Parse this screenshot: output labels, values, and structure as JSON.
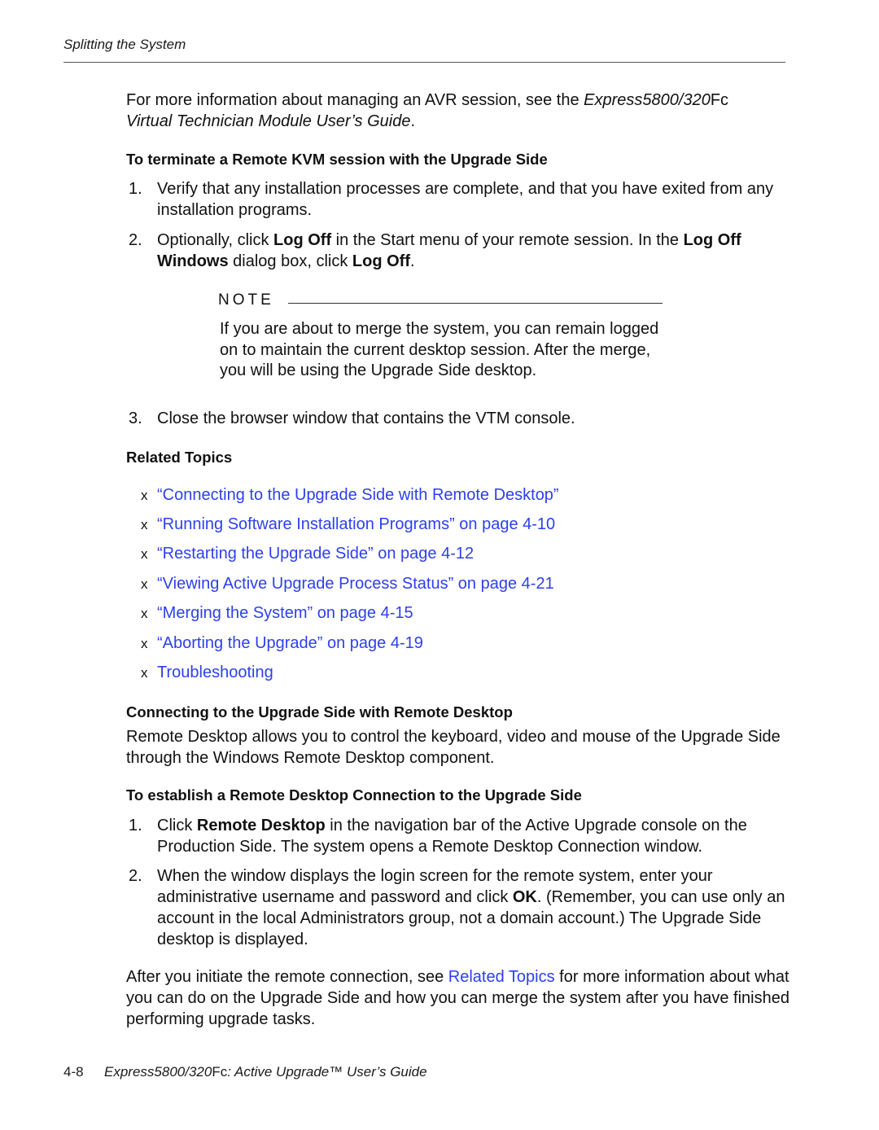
{
  "header": {
    "running_title": "Splitting the System"
  },
  "intro": {
    "text_before": "For more information about managing an AVR session, see the ",
    "guide_italic": "Express5800/320",
    "guide_suffix": "Fc",
    "guide_line2": "Virtual Technician Module User’s Guide",
    "text_after": "."
  },
  "section_kvm": {
    "heading": "To terminate a Remote KVM session with the Upgrade Side",
    "steps": [
      {
        "num": "1.",
        "text": "Verify that any installation processes are complete, and that you have exited from any installation programs."
      },
      {
        "num": "2.",
        "parts": [
          "Optionally, click ",
          "Log Off",
          " in the Start menu of your remote session. In the ",
          "Log Off Windows",
          " dialog box, click ",
          "Log Off",
          "."
        ]
      },
      {
        "num": "3.",
        "text": "Close the browser window that contains the VTM console."
      }
    ],
    "note": {
      "label": "NOTE",
      "text": "If you are about to merge the system, you can remain logged on to maintain the current desktop session. After the merge, you will be using the Upgrade Side desktop."
    }
  },
  "related_topics": {
    "heading": "Related Topics",
    "bullet": "x",
    "items": [
      "“Connecting to the Upgrade Side with Remote Desktop”",
      "“Running Software Installation Programs” on page 4-10",
      "“Restarting the Upgrade Side” on page 4-12",
      "“Viewing Active Upgrade Process Status” on page 4-21",
      "“Merging the System” on page 4-15",
      "“Aborting the Upgrade” on page 4-19",
      "Troubleshooting"
    ]
  },
  "section_rdp": {
    "heading": "Connecting to the Upgrade Side with Remote Desktop",
    "intro": "Remote Desktop allows you to control the keyboard, video and mouse of the Upgrade Side through the Windows Remote Desktop component.",
    "subheading": "To establish a Remote Desktop Connection to the Upgrade Side",
    "steps": [
      {
        "num": "1.",
        "parts": [
          "Click ",
          "Remote Desktop",
          " in the navigation bar of the Active Upgrade console on the Production Side. The system opens a Remote Desktop Connection window."
        ]
      },
      {
        "num": "2.",
        "parts": [
          "When the window displays the login screen for the remote system, enter your administrative username and password and click ",
          "OK",
          ". (Remember, you can use only an account in the local Administrators group, not a domain account.) The Upgrade Side desktop is displayed."
        ]
      }
    ],
    "closing": {
      "before": "After you initiate the remote connection, see ",
      "link": "Related Topics",
      "after": " for more information about what you can do on the Upgrade Side and how you can merge the system after you have finished performing upgrade tasks."
    }
  },
  "footer": {
    "page_number": "4-8",
    "title_italic": "Express5800/320",
    "title_suffix": "Fc",
    "title_rest": ": Active Upgrade™ User’s Guide"
  },
  "colors": {
    "link": "#2d3ff0",
    "text": "#111111"
  }
}
